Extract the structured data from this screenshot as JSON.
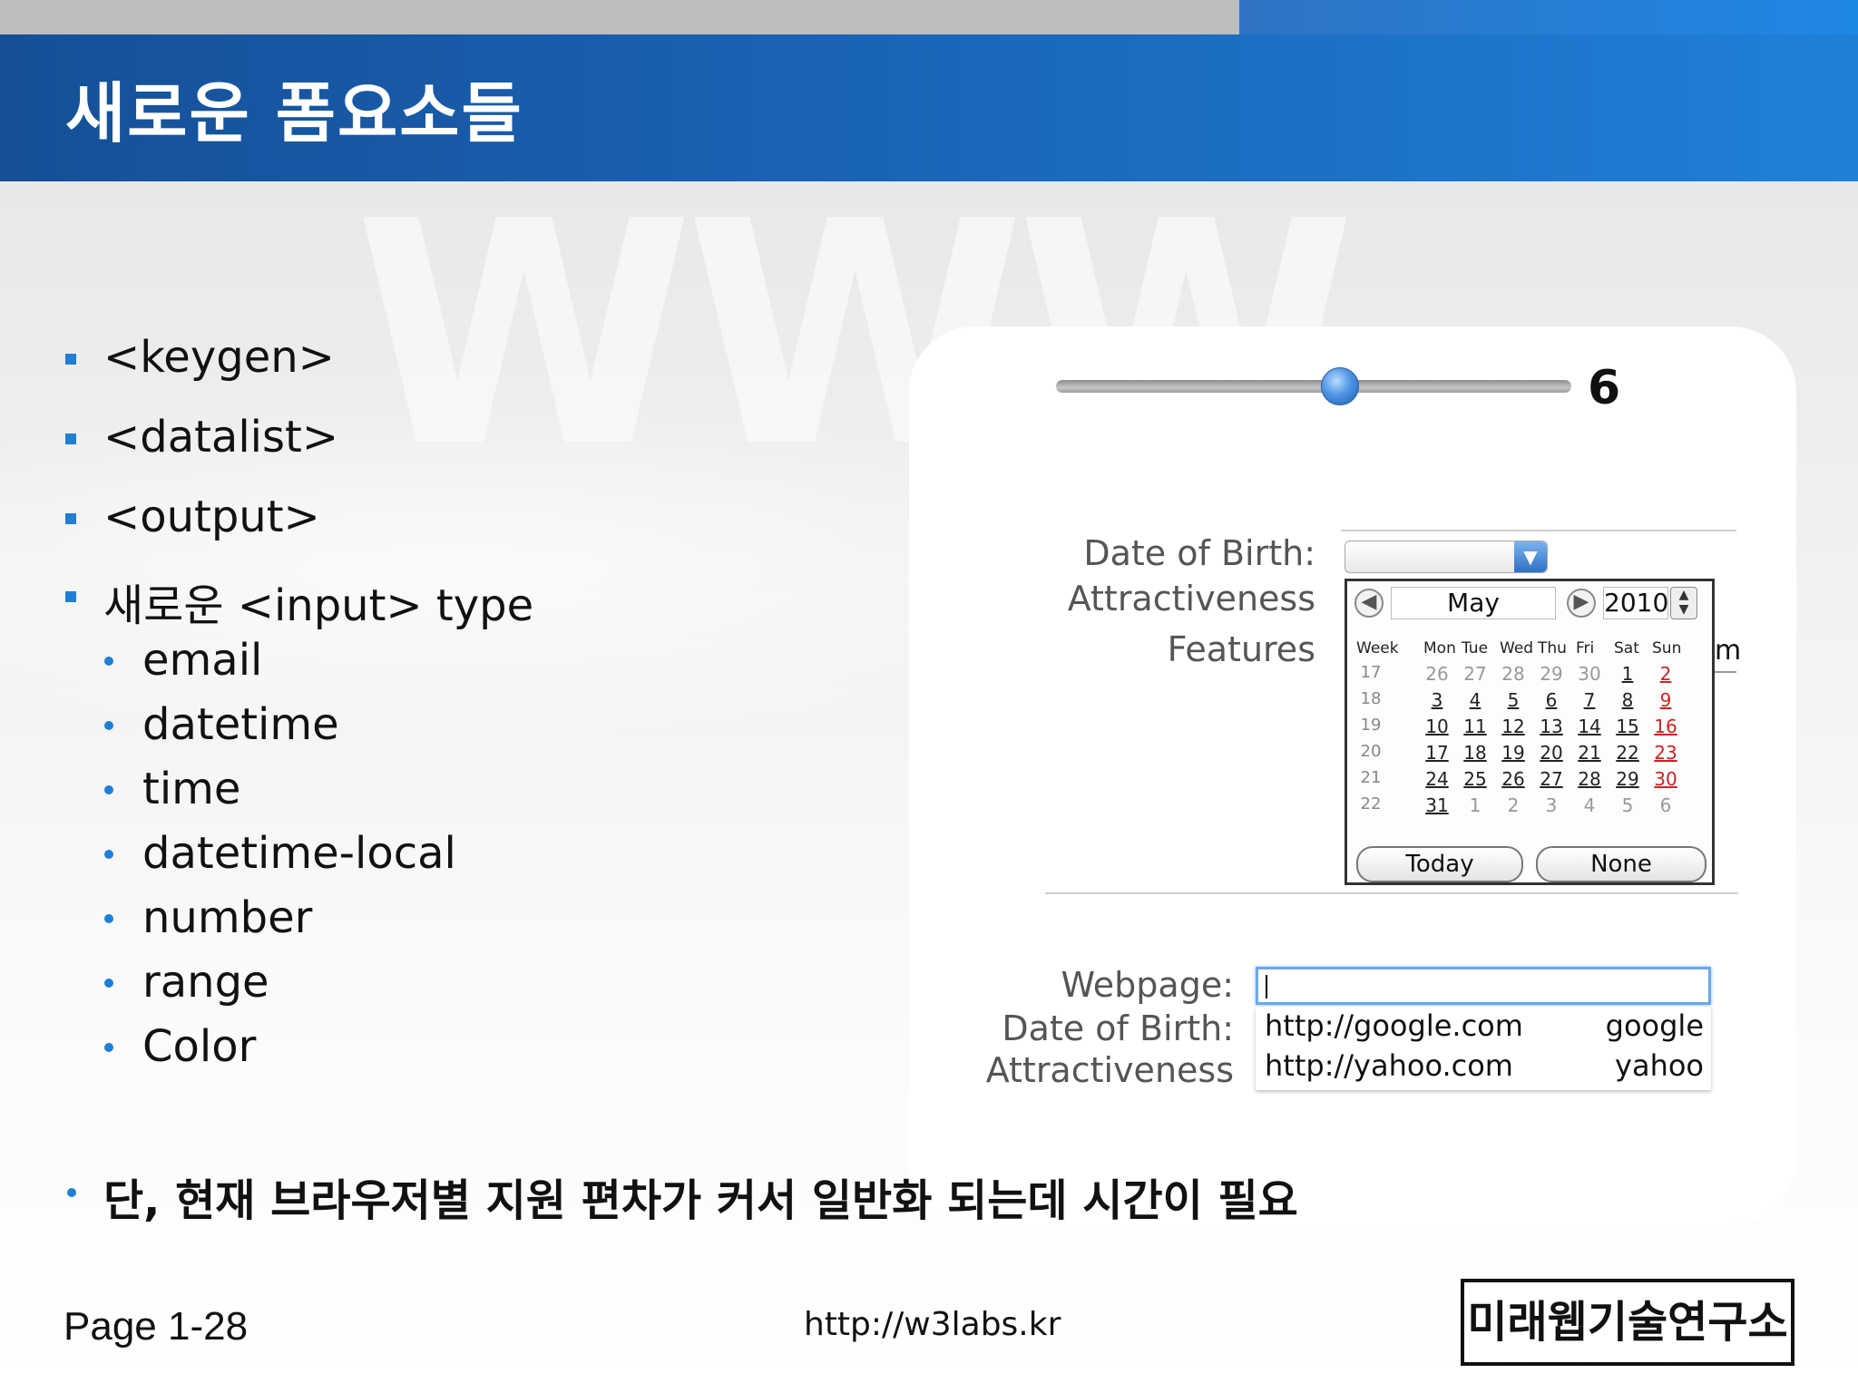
{
  "slide": {
    "title": "새로운 폼요소들",
    "watermark": "WWW",
    "items": [
      {
        "text": "<keygen>",
        "level": 1
      },
      {
        "text": "<datalist>",
        "level": 1
      },
      {
        "text": "<output>",
        "level": 1
      },
      {
        "text": "새로운 <input> type",
        "level": 1
      },
      {
        "text": "email",
        "level": 2
      },
      {
        "text": "datetime",
        "level": 2
      },
      {
        "text": "time",
        "level": 2
      },
      {
        "text": "datetime-local",
        "level": 2
      },
      {
        "text": "number",
        "level": 2
      },
      {
        "text": "range",
        "level": 2
      },
      {
        "text": "Color",
        "level": 2
      }
    ],
    "note": "단, 현재 브라우저별 지원 편차가 커서 일반화 되는데 시간이 필요",
    "page": "Page 1-28",
    "url": "http://w3labs.kr",
    "logo": "미래웹기술연구소"
  },
  "screenshot": {
    "slider": {
      "value": "6",
      "fraction": 0.55
    },
    "form1": {
      "labels": [
        "Date of Birth:",
        "Attractiveness",
        "Features"
      ],
      "calendar": {
        "month": "May",
        "year": "2010",
        "prev_icon": "left-arrow-icon",
        "next_icon": "right-arrow-icon",
        "headers": [
          "Week",
          "Mon",
          "Tue",
          "Wed",
          "Thu",
          "Fri",
          "Sat",
          "Sun"
        ],
        "weeks": [
          {
            "week": "17",
            "days": [
              "26",
              "27",
              "28",
              "29",
              "30",
              "1",
              "2"
            ]
          },
          {
            "week": "18",
            "days": [
              "3",
              "4",
              "5",
              "6",
              "7",
              "8",
              "9"
            ]
          },
          {
            "week": "19",
            "days": [
              "10",
              "11",
              "12",
              "13",
              "14",
              "15",
              "16"
            ]
          },
          {
            "week": "20",
            "days": [
              "17",
              "18",
              "19",
              "20",
              "21",
              "22",
              "23"
            ]
          },
          {
            "week": "21",
            "days": [
              "24",
              "25",
              "26",
              "27",
              "28",
              "29",
              "30"
            ]
          },
          {
            "week": "22",
            "days": [
              "31",
              "1",
              "2",
              "3",
              "4",
              "5",
              "6"
            ]
          }
        ],
        "today_label": "Today",
        "none_label": "None"
      },
      "peek_text": "m"
    },
    "form2": {
      "labels": [
        "Webpage:",
        "Date of Birth:",
        "Attractiveness"
      ],
      "options": [
        {
          "url": "http://google.com",
          "label": "google"
        },
        {
          "url": "http://yahoo.com",
          "label": "yahoo"
        }
      ]
    }
  },
  "colors": {
    "header": "#1a63b6",
    "bullet": "#1f7fd6",
    "weekend": "#cc2222"
  }
}
